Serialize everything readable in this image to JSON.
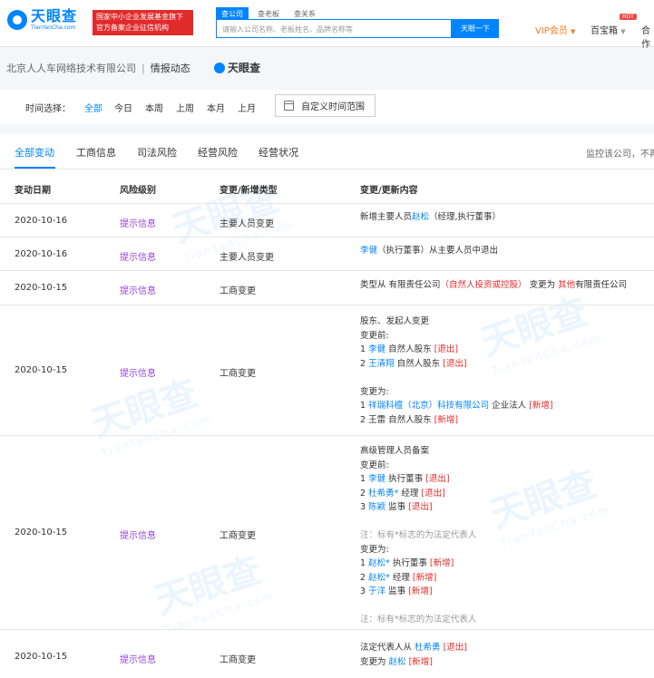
{
  "header": {
    "logo_cn": "天眼查",
    "logo_en": "TianYanCha.com",
    "badge_line1": "国家中小企业发展基金旗下",
    "badge_line2": "官方备案企业征信机构",
    "search_tabs": [
      "查公司",
      "查老板",
      "查关系"
    ],
    "search_placeholder": "请输入公司名称、老板姓名、品牌名称等",
    "search_button": "天眼一下",
    "vip": "VIP会员",
    "treasure": "百宝箱",
    "hot": "HOT",
    "more": "合作"
  },
  "breadcrumb": {
    "company": "北京人人车网络技术有限公司",
    "separator": "|",
    "current": "情报动态",
    "logo": "天眼查"
  },
  "filter": {
    "label": "时间选择：",
    "options": [
      "全部",
      "今日",
      "本周",
      "上周",
      "本月",
      "上月"
    ],
    "custom": "自定义时间范围"
  },
  "tabs": [
    "全部变动",
    "工商信息",
    "司法风险",
    "经营风险",
    "经营状况"
  ],
  "monitor_text": "监控该公司，不再错过",
  "table_headers": [
    "变动日期",
    "风险级别",
    "变更/新增类型",
    "变更/更新内容"
  ],
  "rows": [
    {
      "date": "2020-10-16",
      "risk": "提示信息",
      "type": "主要人员变更",
      "content": [
        [
          {
            "t": "新增主要人员"
          },
          {
            "t": "赵松",
            "c": "blue"
          },
          {
            "t": "（经理,执行董事）"
          }
        ]
      ]
    },
    {
      "date": "2020-10-16",
      "risk": "提示信息",
      "type": "主要人员变更",
      "content": [
        [
          {
            "t": "李健",
            "c": "blue"
          },
          {
            "t": "（执行董事）从主要人员中退出"
          }
        ]
      ]
    },
    {
      "date": "2020-10-15",
      "risk": "提示信息",
      "type": "工商变更",
      "content": [
        [
          {
            "t": "类型从 有限责任公司"
          },
          {
            "t": "（自然人投资或控股）",
            "c": "red"
          },
          {
            "t": " 变更为 "
          },
          {
            "t": "其他",
            "c": "red"
          },
          {
            "t": "有限责任公司"
          }
        ]
      ]
    },
    {
      "date": "2020-10-15",
      "risk": "提示信息",
      "type": "工商变更",
      "content": [
        [
          {
            "t": "股东、发起人变更"
          }
        ],
        [
          {
            "t": "变更前:"
          }
        ],
        [
          {
            "t": "1 "
          },
          {
            "t": "李健",
            "c": "blue"
          },
          {
            "t": " 自然人股东 "
          },
          {
            "t": "[退出]",
            "c": "red"
          }
        ],
        [
          {
            "t": "2 "
          },
          {
            "t": "王清翔",
            "c": "blue"
          },
          {
            "t": " 自然人股东 "
          },
          {
            "t": "[退出]",
            "c": "red"
          }
        ],
        [
          {
            "t": ""
          }
        ],
        [
          {
            "t": "变更为:"
          }
        ],
        [
          {
            "t": "1 "
          },
          {
            "t": "祥瑞科檀（北京）科技有限公司",
            "c": "blue"
          },
          {
            "t": " 企业法人 "
          },
          {
            "t": "[新增]",
            "c": "red"
          }
        ],
        [
          {
            "t": "2 王雷 自然人股东 "
          },
          {
            "t": "[新增]",
            "c": "red"
          }
        ]
      ]
    },
    {
      "date": "2020-10-15",
      "risk": "提示信息",
      "type": "工商变更",
      "content": [
        [
          {
            "t": "高级管理人员备案"
          }
        ],
        [
          {
            "t": "变更前:"
          }
        ],
        [
          {
            "t": "1 "
          },
          {
            "t": "李健",
            "c": "blue"
          },
          {
            "t": " 执行董事 "
          },
          {
            "t": "[退出]",
            "c": "red"
          }
        ],
        [
          {
            "t": "2 "
          },
          {
            "t": "杜希勇*",
            "c": "blue"
          },
          {
            "t": " 经理 "
          },
          {
            "t": "[退出]",
            "c": "red"
          }
        ],
        [
          {
            "t": "3 "
          },
          {
            "t": "陈颖",
            "c": "blue"
          },
          {
            "t": " 监事 "
          },
          {
            "t": "[退出]",
            "c": "red"
          }
        ],
        [
          {
            "t": ""
          }
        ],
        [
          {
            "t": "注：标有*标志的为法定代表人",
            "c": "gray"
          }
        ],
        [
          {
            "t": "变更为:"
          }
        ],
        [
          {
            "t": "1 "
          },
          {
            "t": "赵松*",
            "c": "blue"
          },
          {
            "t": " 执行董事 "
          },
          {
            "t": "[新增]",
            "c": "red"
          }
        ],
        [
          {
            "t": "2 "
          },
          {
            "t": "赵松*",
            "c": "blue"
          },
          {
            "t": " 经理 "
          },
          {
            "t": "[新增]",
            "c": "red"
          }
        ],
        [
          {
            "t": "3 "
          },
          {
            "t": "于洋",
            "c": "blue"
          },
          {
            "t": " 监事 "
          },
          {
            "t": "[新增]",
            "c": "red"
          }
        ],
        [
          {
            "t": ""
          }
        ],
        [
          {
            "t": "注：标有*标志的为法定代表人",
            "c": "gray"
          }
        ]
      ]
    },
    {
      "date": "2020-10-15",
      "risk": "提示信息",
      "type": "工商变更",
      "content": [
        [
          {
            "t": "法定代表人从 "
          },
          {
            "t": "杜希勇",
            "c": "blue"
          },
          {
            "t": " "
          },
          {
            "t": "[退出]",
            "c": "red"
          }
        ],
        [
          {
            "t": "变更为 "
          },
          {
            "t": "赵松",
            "c": "blue"
          },
          {
            "t": " "
          },
          {
            "t": "[新增]",
            "c": "red"
          }
        ]
      ]
    }
  ],
  "watermark": {
    "cn": "天眼查",
    "en": "TianYanCha.com"
  },
  "colors": {
    "accent": "#0084ff",
    "risk": "#9146d6",
    "warn": "#e12b2b",
    "vip": "#f27c1c"
  }
}
